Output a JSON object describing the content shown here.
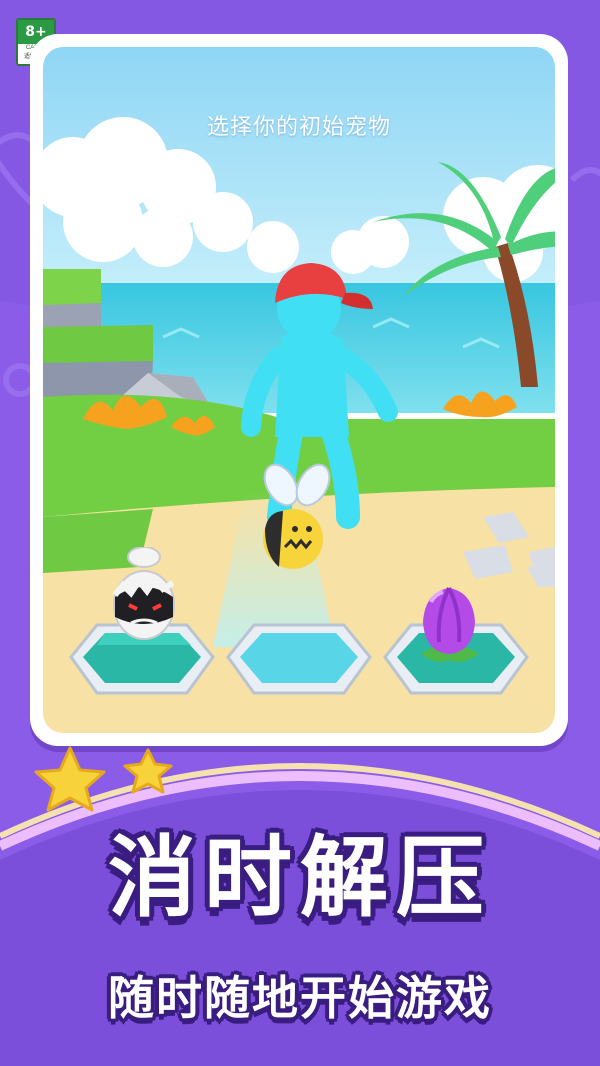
{
  "rating": {
    "age": "8+",
    "org": "CADPA",
    "note": "适龄提示"
  },
  "scene": {
    "caption": "选择你的初始宠物"
  },
  "pets": [
    {
      "name": "egg-monster",
      "icon": "cracked-egg-monster-icon"
    },
    {
      "name": "bee",
      "icon": "bee-icon"
    },
    {
      "name": "flower-bud",
      "icon": "purple-flower-bud-icon"
    }
  ],
  "promo": {
    "headline": "消时解压",
    "subline": "随时随地开始游戏"
  },
  "colors": {
    "background": "#8a5ce8",
    "accent": "#f7d23a",
    "outline": "#3a1d80"
  }
}
